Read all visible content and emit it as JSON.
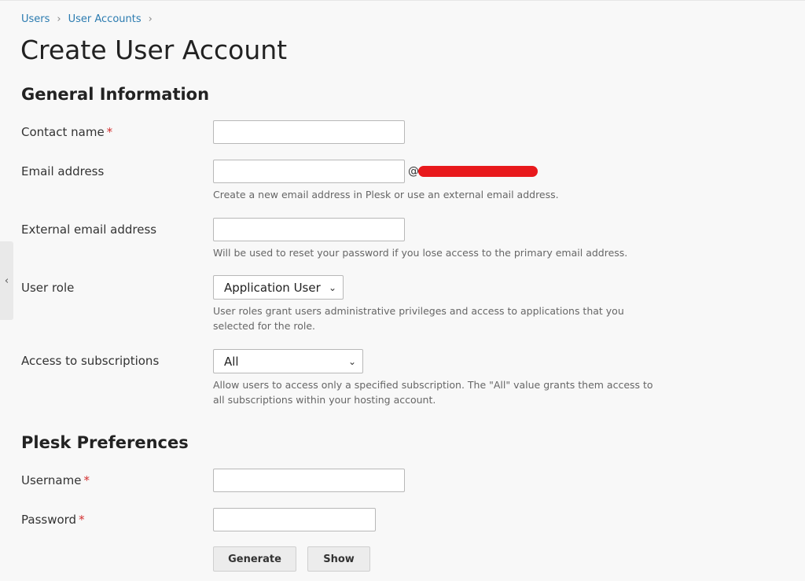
{
  "breadcrumb": {
    "items": [
      {
        "label": "Users"
      },
      {
        "label": "User Accounts"
      }
    ],
    "separator": "›"
  },
  "page": {
    "title": "Create User Account"
  },
  "general": {
    "heading": "General Information",
    "contact_name": {
      "label": "Contact name",
      "required_mark": "*",
      "value": ""
    },
    "email": {
      "label": "Email address",
      "value": "",
      "at": "@",
      "hint": "Create a new email address in Plesk or use an external email address."
    },
    "external_email": {
      "label": "External email address",
      "value": "",
      "hint": "Will be used to reset your password if you lose access to the primary email address."
    },
    "user_role": {
      "label": "User role",
      "selected": "Application User",
      "hint": "User roles grant users administrative privileges and access to applications that you selected for the role."
    },
    "subscriptions": {
      "label": "Access to subscriptions",
      "selected": "All",
      "hint": "Allow users to access only a specified subscription. The \"All\" value grants them access to all subscriptions within your hosting account."
    }
  },
  "plesk": {
    "heading": "Plesk Preferences",
    "username": {
      "label": "Username",
      "required_mark": "*",
      "value": ""
    },
    "password": {
      "label": "Password",
      "required_mark": "*",
      "value": ""
    },
    "generate_label": "Generate",
    "show_label": "Show"
  },
  "icons": {
    "collapse": "‹",
    "chevron": "⌄"
  },
  "colors": {
    "link": "#2b7bb0",
    "required": "#d32f2f",
    "redaction": "#e8191c"
  }
}
